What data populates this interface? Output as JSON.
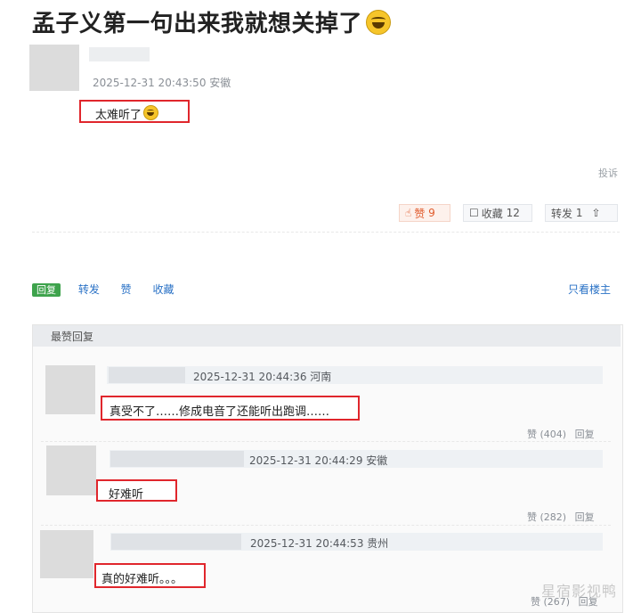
{
  "post": {
    "title": "孟子义第一句出来我就想关掉了",
    "meta": "2025-12-31 20:43:50 安徽",
    "content": "太难听了",
    "report_label": "投诉"
  },
  "actions": {
    "like_label": "赞",
    "like_count": "9",
    "fav_label": "收藏",
    "fav_count": "12",
    "share_label": "转发",
    "share_count": "1"
  },
  "tabs": {
    "reply_label": "回复",
    "share_label": "转发",
    "like_label": "赞",
    "fav_label": "收藏",
    "only_op_label": "只看楼主"
  },
  "best": {
    "header": "最赞回复",
    "replies": [
      {
        "meta": "2025-12-31 20:44:36 河南",
        "text": "真受不了……修成电音了还能听出跑调……",
        "likes": "赞 (404)",
        "reply": "回复"
      },
      {
        "meta": "2025-12-31 20:44:29 安徽",
        "text": "好难听",
        "likes": "赞 (282)",
        "reply": "回复"
      },
      {
        "meta": "2025-12-31 20:44:53 贵州",
        "text": "真的好难听。。。",
        "likes": "赞 (267)",
        "reply": "回复"
      }
    ]
  },
  "watermark": "星宿影视鸭",
  "icons": [
    "laugh-emoji-icon",
    "thumb-up-icon",
    "bookmark-icon",
    "share-icon"
  ],
  "colors": {
    "accent_red": "#e0262c",
    "link_blue": "#2a72c6",
    "reply_green": "#3ea34c",
    "like_orange": "#e05a2b"
  }
}
